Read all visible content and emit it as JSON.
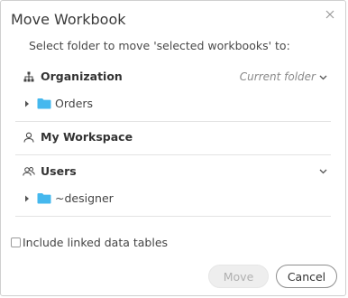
{
  "dialog": {
    "title": "Move Workbook",
    "subtitle": "Select folder to move 'selected workbooks' to:"
  },
  "sections": {
    "organization": {
      "title": "Organization",
      "current_folder": "Current folder",
      "items": [
        {
          "label": "Orders"
        }
      ]
    },
    "workspace": {
      "title": "My Workspace"
    },
    "users": {
      "title": "Users",
      "items": [
        {
          "label": "~designer"
        }
      ]
    }
  },
  "options": {
    "include_linked_label": "Include linked data tables",
    "include_linked_checked": false
  },
  "buttons": {
    "move_label": "Move",
    "cancel_label": "Cancel"
  },
  "colors": {
    "folder": "#45b8ee",
    "muted_text": "#8a8a8a",
    "divider": "#e3e3e3"
  },
  "icons": {
    "close": "close-icon",
    "organization": "org-tree-icon",
    "workspace": "user-icon",
    "users": "users-icon",
    "folder": "folder-icon",
    "expand": "caret-right-icon",
    "dropdown": "chevron-down-icon"
  }
}
